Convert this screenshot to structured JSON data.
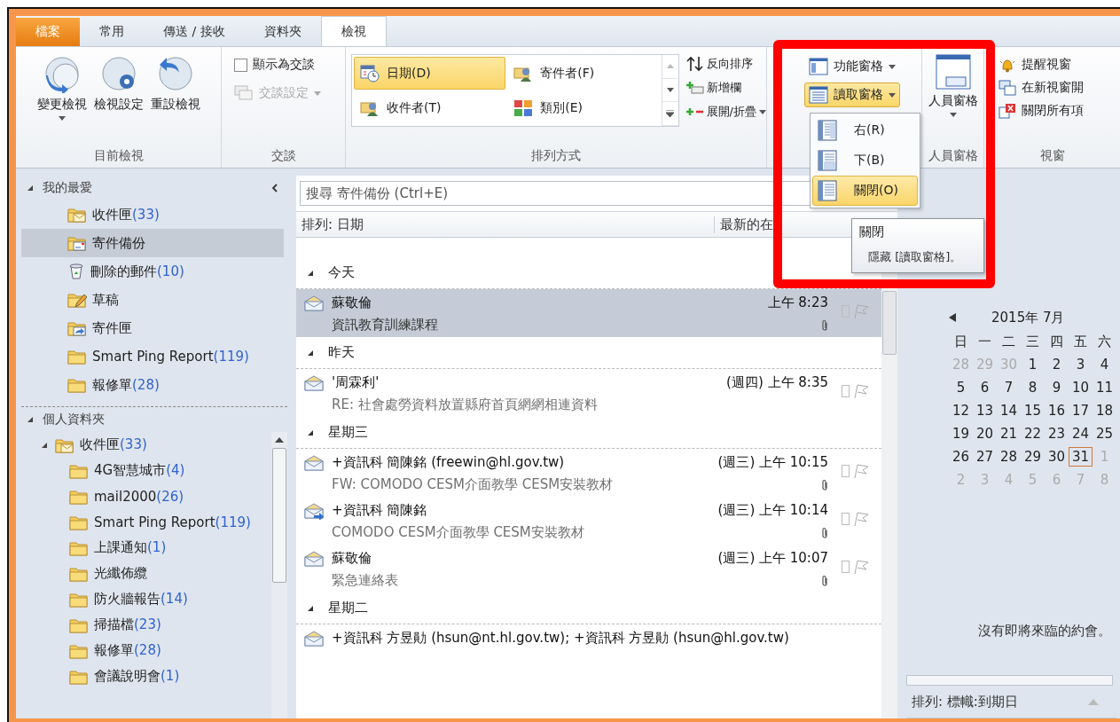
{
  "tabs": [
    {
      "label": "檔案",
      "kind": "file",
      "selected": false
    },
    {
      "label": "常用",
      "kind": "normal",
      "selected": false
    },
    {
      "label": "傳送 / 接收",
      "kind": "normal",
      "selected": false
    },
    {
      "label": "資料夾",
      "kind": "normal",
      "selected": false
    },
    {
      "label": "檢視",
      "kind": "normal",
      "selected": true
    }
  ],
  "ribbon": {
    "current_view": {
      "label": "目前檢視",
      "buttons": [
        {
          "label": "變更檢視",
          "dropdown": true
        },
        {
          "label": "檢視設定",
          "dropdown": false
        },
        {
          "label": "重設檢視",
          "dropdown": false
        }
      ]
    },
    "conversations": {
      "label": "交談",
      "show_as_conversations": {
        "label": "顯示為交談",
        "checked": false
      },
      "settings": {
        "label": "交談設定",
        "disabled": true
      }
    },
    "arrangement": {
      "label": "排列方式",
      "gallery": [
        {
          "label": "日期(D)",
          "selected": true
        },
        {
          "label": "寄件者(F)",
          "selected": false
        },
        {
          "label": "收件者(T)",
          "selected": false
        },
        {
          "label": "類別(E)",
          "selected": false
        }
      ],
      "commands": [
        {
          "label": "反向排序",
          "dropdown": false
        },
        {
          "label": "新增欄",
          "dropdown": false
        },
        {
          "label": "展開/折疊",
          "dropdown": true
        }
      ]
    },
    "layout": {
      "buttons": [
        {
          "label": "功能窗格",
          "active": false
        },
        {
          "label": "讀取窗格",
          "active": true
        }
      ],
      "menu": {
        "items": [
          {
            "label": "右(R)",
            "selected": false
          },
          {
            "label": "下(B)",
            "selected": false
          },
          {
            "label": "關閉(O)",
            "selected": true
          }
        ]
      },
      "tooltip": {
        "title": "關閉",
        "text": "隱藏 [讀取窗格]。"
      }
    },
    "people_pane": {
      "button": "人員窗格",
      "label": "人員窗格"
    },
    "window": {
      "label": "視窗",
      "commands": [
        {
          "label": "提醒視窗"
        },
        {
          "label": "在新視窗開"
        },
        {
          "label": "關閉所有項"
        }
      ]
    }
  },
  "sidebar": {
    "favorites": {
      "title": "我的最愛",
      "expanded": true,
      "items": [
        {
          "name": "收件匣",
          "count": "(33)",
          "kind": "inbox",
          "selected": false
        },
        {
          "name": "寄件備份",
          "kind": "sent",
          "selected": true
        },
        {
          "name": "刪除的郵件",
          "count": "(10)",
          "kind": "deleted",
          "selected": false
        },
        {
          "name": "草稿",
          "kind": "drafts",
          "selected": false
        },
        {
          "name": "寄件匣",
          "kind": "outbox",
          "selected": false
        },
        {
          "name": "Smart Ping Report",
          "count": "(119)",
          "kind": "folder",
          "selected": false
        },
        {
          "name": "報修單",
          "count": "(28)",
          "kind": "folder",
          "selected": false
        }
      ]
    },
    "personal": {
      "title": "個人資料夾",
      "expanded": true,
      "items": [
        {
          "name": "收件匣",
          "count": "(33)",
          "kind": "inbox",
          "selected": false,
          "expanded": true,
          "children": [
            {
              "name": "4G智慧城市",
              "count": "(4)",
              "kind": "folder",
              "selected": false
            },
            {
              "name": "mail2000",
              "count": "(26)",
              "kind": "folder",
              "selected": false
            },
            {
              "name": "Smart Ping Report",
              "count": "(119)",
              "kind": "folder",
              "selected": false
            },
            {
              "name": "上課通知",
              "count": "(1)",
              "kind": "folder",
              "selected": false
            },
            {
              "name": "光纖佈纜",
              "kind": "folder",
              "selected": false
            },
            {
              "name": "防火牆報告",
              "count": "(14)",
              "kind": "folder",
              "selected": false
            },
            {
              "name": "掃描檔",
              "count": "(23)",
              "kind": "folder",
              "selected": false
            },
            {
              "name": "報修單",
              "count": "(28)",
              "kind": "folder",
              "selected": false
            },
            {
              "name": "會議說明會",
              "count": "(1)",
              "kind": "folder",
              "selected": false
            }
          ]
        }
      ]
    }
  },
  "mail": {
    "search": {
      "placeholder": "搜尋 寄件備份 (Ctrl+E)"
    },
    "sort_label": "排列: 日期",
    "order_label": "最新的在",
    "groups": [
      {
        "title": "今天",
        "expanded": true,
        "messages": [
          {
            "sender": "蘇敬倫",
            "time": "上午 8:23",
            "subject": "資訊教育訓練課程",
            "attachment": true,
            "selected": true,
            "kind": "envelope"
          }
        ]
      },
      {
        "title": "昨天",
        "expanded": true,
        "messages": [
          {
            "sender": "'周霖利'",
            "time": "(週四) 上午 8:35",
            "subject": "RE: 社會處勞資料放置縣府首頁網網相連資料",
            "attachment": false,
            "selected": false,
            "kind": "envelope"
          }
        ]
      },
      {
        "title": "星期三",
        "expanded": true,
        "messages": [
          {
            "sender": "+資訊科 簡陳銘 (freewin@hl.gov.tw)",
            "time": "(週三) 上午 10:15",
            "subject": "FW: COMODO CESM介面教學 CESM安裝教材",
            "attachment": true,
            "selected": false,
            "kind": "envelope"
          },
          {
            "sender": "+資訊科 簡陳銘",
            "time": "(週三) 上午 10:14",
            "subject": "COMODO CESM介面教學 CESM安裝教材",
            "attachment": true,
            "selected": false,
            "kind": "forwarded"
          },
          {
            "sender": "蘇敬倫",
            "time": "(週三) 上午 10:07",
            "subject": "緊急連絡表",
            "attachment": true,
            "selected": false,
            "kind": "envelope"
          }
        ]
      },
      {
        "title": "星期二",
        "expanded": true,
        "messages": [
          {
            "sender": "+資訊科 方昱勛 (hsun@nt.hl.gov.tw); +資訊科 方昱勛 (hsun@hl.gov.tw)",
            "selected": false,
            "kind": "envelope"
          }
        ]
      }
    ]
  },
  "todo": {
    "calendar": {
      "title": "2015年 7月",
      "weekdays": [
        "日",
        "一",
        "二",
        "三",
        "四",
        "五",
        "六"
      ],
      "weeks": [
        [
          {
            "d": "28",
            "other": true,
            "today": false
          },
          {
            "d": "29",
            "other": true,
            "today": false
          },
          {
            "d": "30",
            "other": true,
            "today": false
          },
          {
            "d": "1",
            "other": false,
            "today": false
          },
          {
            "d": "2",
            "other": false,
            "today": false
          },
          {
            "d": "3",
            "other": false,
            "today": false
          },
          {
            "d": "4",
            "other": false,
            "today": false
          }
        ],
        [
          {
            "d": "5",
            "other": false,
            "today": false
          },
          {
            "d": "6",
            "other": false,
            "today": false
          },
          {
            "d": "7",
            "other": false,
            "today": false
          },
          {
            "d": "8",
            "other": false,
            "today": false
          },
          {
            "d": "9",
            "other": false,
            "today": false
          },
          {
            "d": "10",
            "other": false,
            "today": false
          },
          {
            "d": "11",
            "other": false,
            "today": false
          }
        ],
        [
          {
            "d": "12",
            "other": false,
            "today": false
          },
          {
            "d": "13",
            "other": false,
            "today": false
          },
          {
            "d": "14",
            "other": false,
            "today": false
          },
          {
            "d": "15",
            "other": false,
            "today": false
          },
          {
            "d": "16",
            "other": false,
            "today": false
          },
          {
            "d": "17",
            "other": false,
            "today": false
          },
          {
            "d": "18",
            "other": false,
            "today": false
          }
        ],
        [
          {
            "d": "19",
            "other": false,
            "today": false
          },
          {
            "d": "20",
            "other": false,
            "today": false
          },
          {
            "d": "21",
            "other": false,
            "today": false
          },
          {
            "d": "22",
            "other": false,
            "today": false
          },
          {
            "d": "23",
            "other": false,
            "today": false
          },
          {
            "d": "24",
            "other": false,
            "today": false
          },
          {
            "d": "25",
            "other": false,
            "today": false
          }
        ],
        [
          {
            "d": "26",
            "other": false,
            "today": false
          },
          {
            "d": "27",
            "other": false,
            "today": false
          },
          {
            "d": "28",
            "other": false,
            "today": false
          },
          {
            "d": "29",
            "other": false,
            "today": false
          },
          {
            "d": "30",
            "other": false,
            "today": false
          },
          {
            "d": "31",
            "other": false,
            "today": true
          },
          {
            "d": "1",
            "other": true,
            "today": false
          }
        ],
        [
          {
            "d": "2",
            "other": true,
            "today": false
          },
          {
            "d": "3",
            "other": true,
            "today": false
          },
          {
            "d": "4",
            "other": true,
            "today": false
          },
          {
            "d": "5",
            "other": true,
            "today": false
          },
          {
            "d": "6",
            "other": true,
            "today": false
          },
          {
            "d": "7",
            "other": true,
            "today": false
          },
          {
            "d": "8",
            "other": true,
            "today": false
          }
        ]
      ]
    },
    "no_appointments": "沒有即將來臨的約會。",
    "task_sort": "排列: 標幟:到期日"
  }
}
